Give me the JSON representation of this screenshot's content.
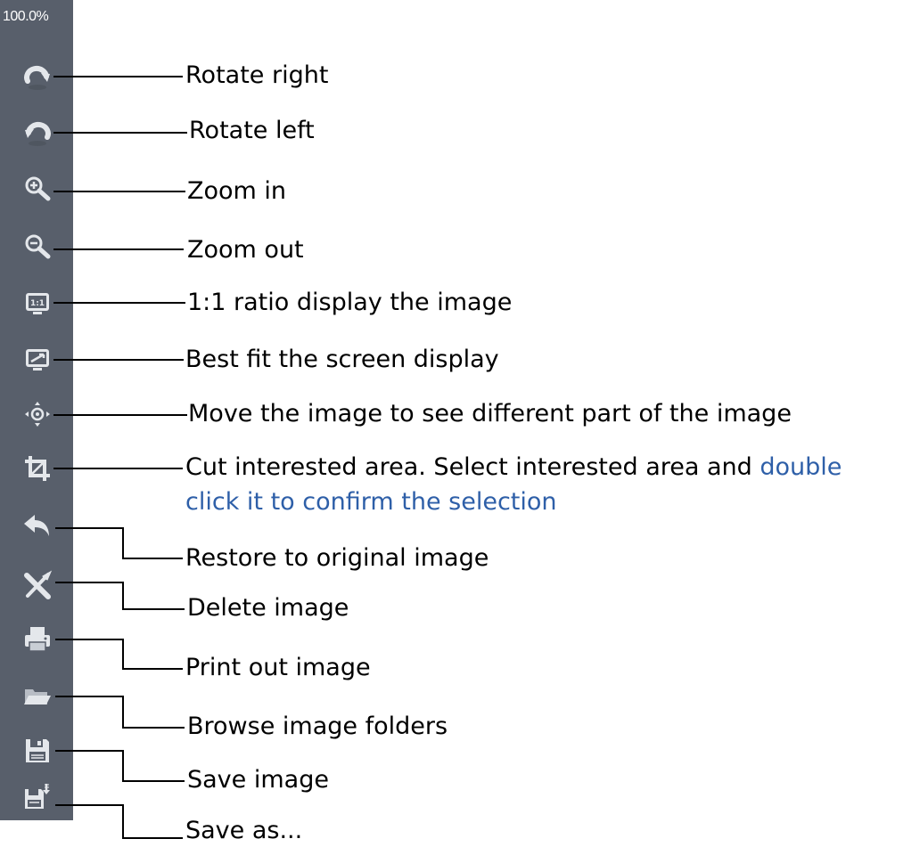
{
  "toolbar": {
    "zoom_level": "100.0%",
    "background_color": "#585f6b",
    "icon_color": "#e4e7eb",
    "buttons": [
      {
        "name": "rotate-right",
        "icon": "rotate-right-icon"
      },
      {
        "name": "rotate-left",
        "icon": "rotate-left-icon"
      },
      {
        "name": "zoom-in",
        "icon": "zoom-in-icon"
      },
      {
        "name": "zoom-out",
        "icon": "zoom-out-icon"
      },
      {
        "name": "actual-size",
        "icon": "one-to-one-icon",
        "glyph": "1:1"
      },
      {
        "name": "best-fit",
        "icon": "fit-screen-icon"
      },
      {
        "name": "move",
        "icon": "move-icon"
      },
      {
        "name": "crop",
        "icon": "crop-icon"
      },
      {
        "name": "restore",
        "icon": "undo-arrow-icon"
      },
      {
        "name": "delete",
        "icon": "delete-x-icon"
      },
      {
        "name": "print",
        "icon": "printer-icon"
      },
      {
        "name": "browse-folders",
        "icon": "folder-icon"
      },
      {
        "name": "save",
        "icon": "floppy-disk-icon"
      },
      {
        "name": "save-as",
        "icon": "save-as-icon"
      }
    ]
  },
  "callouts": {
    "rotate_right": "Rotate right",
    "rotate_left": "Rotate left",
    "zoom_in": "Zoom in",
    "zoom_out": "Zoom out",
    "ratio_1_1": "1:1 ratio display the image",
    "best_fit": "Best fit the screen display",
    "move": "Move the image to see different part of the image",
    "cut_line1_plain": "Cut interested area. Select interested area and ",
    "cut_line1_highlight": "double",
    "cut_line2_highlight": "click it to confirm the selection",
    "restore": "Restore to original image",
    "delete": "Delete image",
    "print": "Print out image",
    "browse": "Browse image folders",
    "save": "Save image",
    "save_as": "Save as...",
    "highlight_color": "#2e5fa8"
  }
}
